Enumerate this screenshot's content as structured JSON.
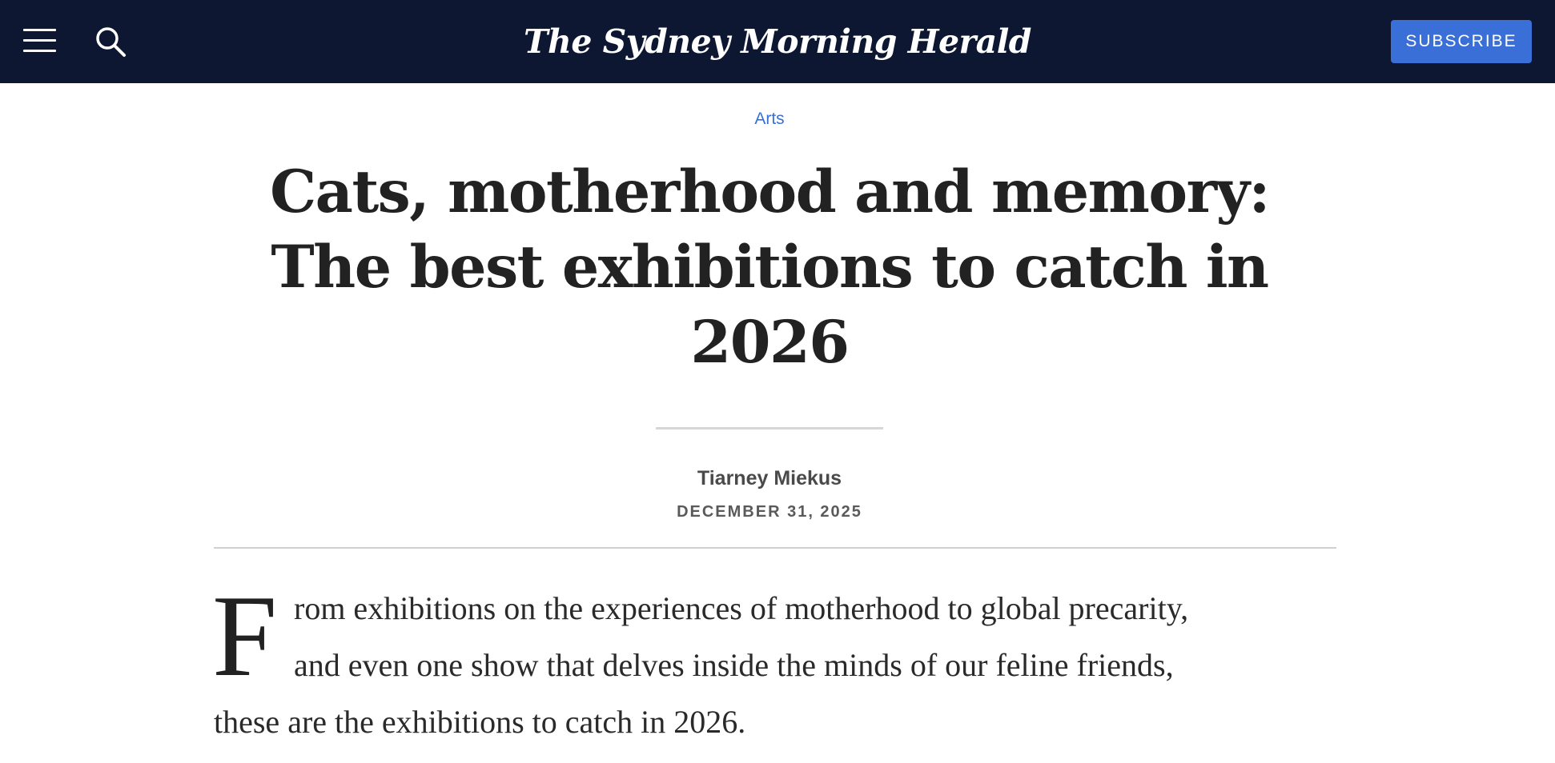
{
  "header": {
    "menu_icon": "hamburger-menu-icon",
    "search_icon": "search-icon",
    "masthead": "The Sydney Morning Herald",
    "subscribe_label": "SUBSCRIBE",
    "background_color": "#0d1731",
    "accent_color": "#3a6fd8"
  },
  "article": {
    "section": "Arts",
    "headline": "Cats, motherhood and memory: The best exhibitions to catch in 2026",
    "author": "Tiarney Miekus",
    "date": "DECEMBER 31, 2025",
    "intro": {
      "drop_cap": "F",
      "lines": [
        "rom exhibitions on the experiences of motherhood to global precarity,",
        "and even one show that delves inside the minds of our feline friends,",
        "these are the exhibitions to catch in 2026."
      ]
    }
  }
}
